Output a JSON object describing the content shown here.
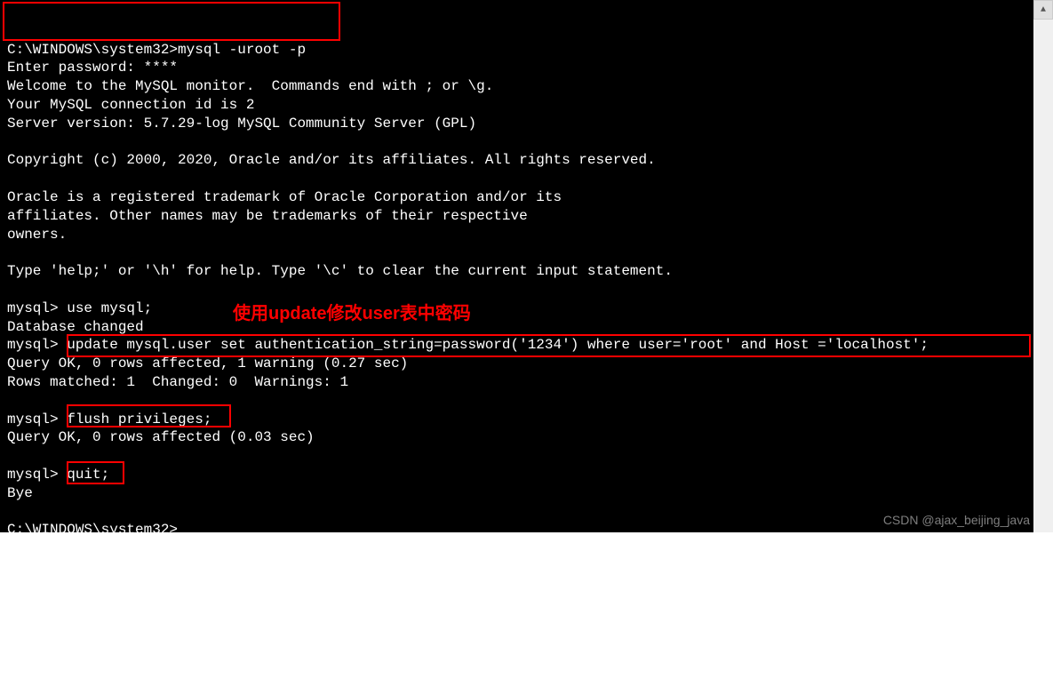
{
  "terminal": {
    "lines": [
      "C:\\WINDOWS\\system32>mysql -uroot -p",
      "Enter password: ****",
      "Welcome to the MySQL monitor.  Commands end with ; or \\g.",
      "Your MySQL connection id is 2",
      "Server version: 5.7.29-log MySQL Community Server (GPL)",
      "",
      "Copyright (c) 2000, 2020, Oracle and/or its affiliates. All rights reserved.",
      "",
      "Oracle is a registered trademark of Oracle Corporation and/or its",
      "affiliates. Other names may be trademarks of their respective",
      "owners.",
      "",
      "Type 'help;' or '\\h' for help. Type '\\c' to clear the current input statement.",
      "",
      "mysql> use mysql;",
      "Database changed",
      "mysql> update mysql.user set authentication_string=password('1234') where user='root' and Host ='localhost';",
      "Query OK, 0 rows affected, 1 warning (0.27 sec)",
      "Rows matched: 1  Changed: 0  Warnings: 1",
      "",
      "mysql> flush privileges;",
      "Query OK, 0 rows affected (0.03 sec)",
      "",
      "mysql> quit;",
      "Bye",
      "",
      "C:\\WINDOWS\\system32>"
    ]
  },
  "annotation": {
    "text": "使用update修改user表中密码"
  },
  "watermark": {
    "text": "CSDN @ajax_beijing_java"
  },
  "scrollbar": {
    "up_icon": "▲"
  }
}
